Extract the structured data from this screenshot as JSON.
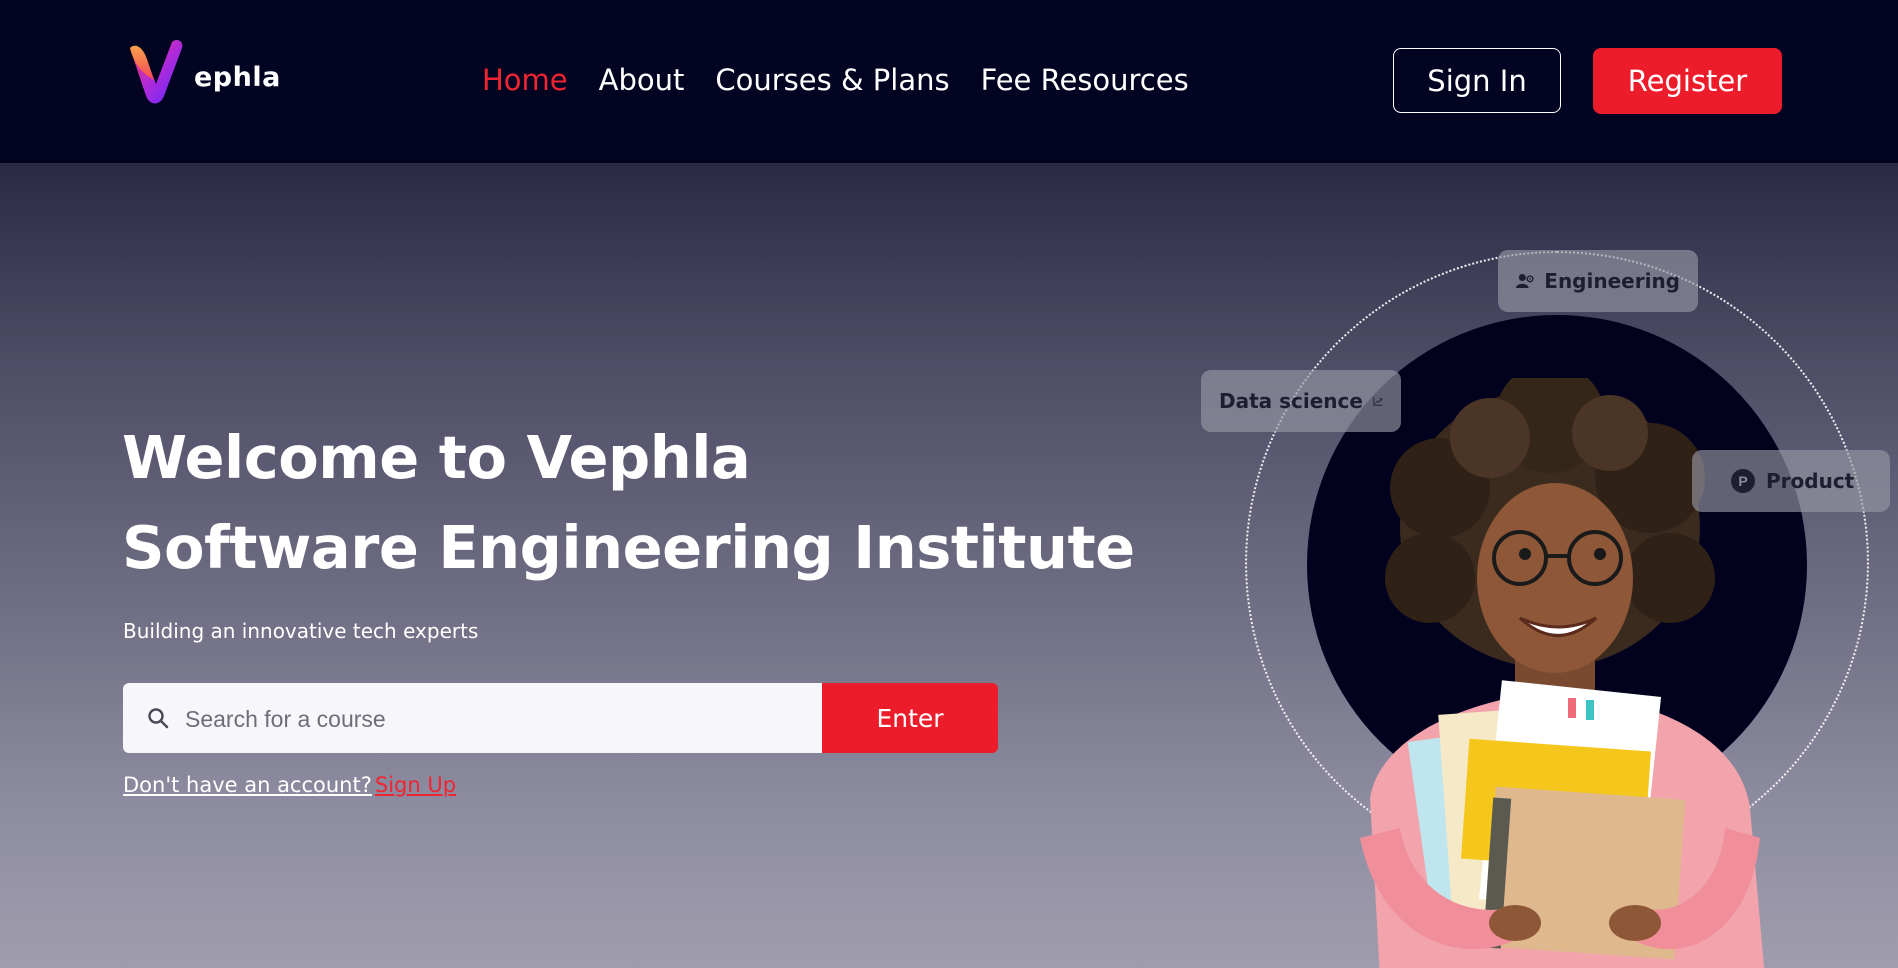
{
  "brand": {
    "name": "ephla",
    "colors": {
      "accent": "#ed1c2b",
      "header_bg": "#030322",
      "dark_circle": "#02021f"
    }
  },
  "nav": {
    "items": [
      {
        "label": "Home",
        "active": true
      },
      {
        "label": "About",
        "active": false
      },
      {
        "label": "Courses & Plans",
        "active": false
      },
      {
        "label": "Fee Resources",
        "active": false
      }
    ]
  },
  "auth": {
    "sign_in_label": "Sign In",
    "register_label": "Register"
  },
  "hero": {
    "title_line1": "Welcome to Vephla",
    "title_line2": "Software Engineering Institute",
    "subtitle": "Building an innovative tech experts",
    "search": {
      "placeholder": "Search for a course",
      "value": "",
      "icon": "search-icon"
    },
    "enter_label": "Enter",
    "account_prompt": "Don't have an account?",
    "signup_label": "Sign Up"
  },
  "chips": {
    "engineering": {
      "label": "Engineering",
      "icon": "user-gear-icon"
    },
    "data_science": {
      "label": "Data science",
      "icon": "chart-icon"
    },
    "product": {
      "label": "Product",
      "icon": "product-p-icon"
    }
  }
}
